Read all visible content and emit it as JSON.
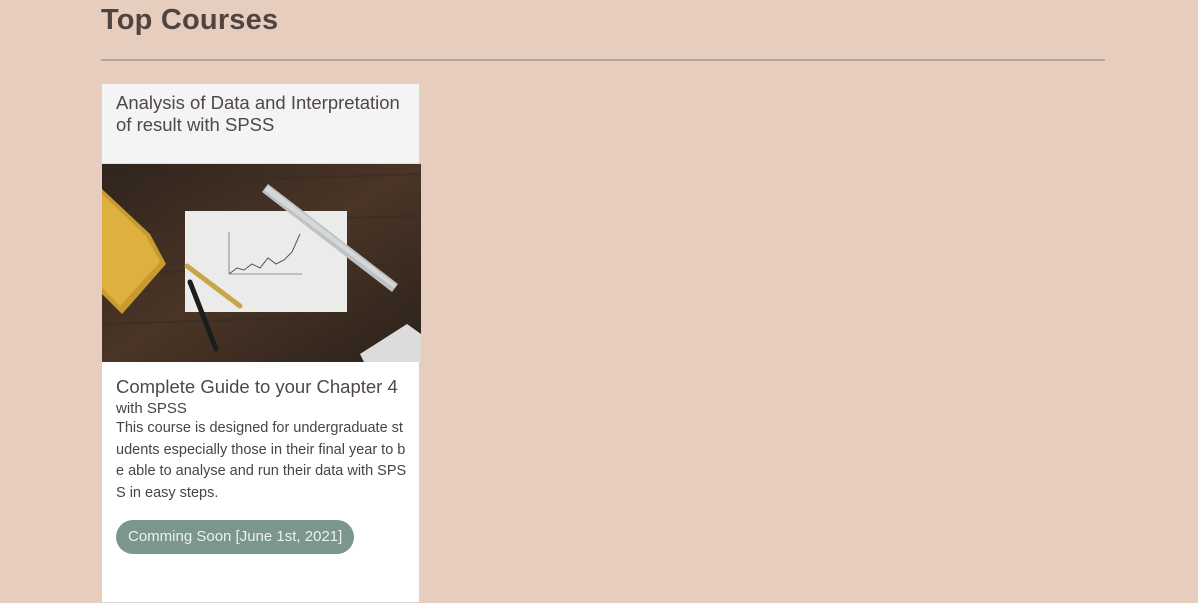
{
  "section": {
    "title": "Top Courses"
  },
  "course": {
    "header_title": "Analysis of Data and Interpretation of result with SPSS",
    "image_icon": "desk-chart-photo",
    "title": "Complete Guide to your Chapter 4",
    "subtitle": "with SPSS",
    "description": "This course is designed for undergraduate students especially those in their final year to be able to analyse and run their data with SPSS in easy steps.",
    "status_label": "Comming Soon [June 1st, 2021]"
  },
  "colors": {
    "page_background": "#e6cdbd",
    "status_button": "#7b968a"
  }
}
